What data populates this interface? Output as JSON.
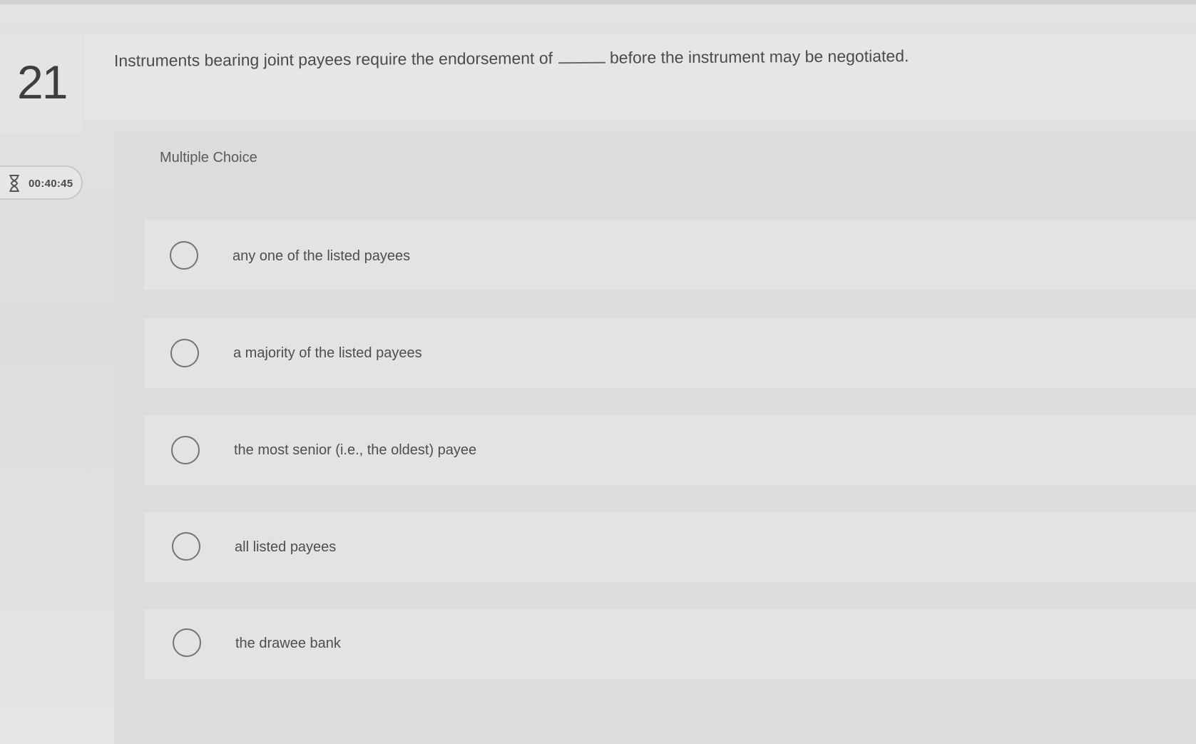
{
  "question": {
    "number": "21",
    "prompt_before": "Instruments bearing joint payees require the endorsement of",
    "prompt_after": "before the instrument may be negotiated."
  },
  "timer": {
    "icon": "hourglass-icon",
    "value": "00:40:45"
  },
  "question_type": "Multiple Choice",
  "options": [
    {
      "label": "any one of the listed payees"
    },
    {
      "label": "a majority of the listed payees"
    },
    {
      "label": "the most senior (i.e., the oldest) payee"
    },
    {
      "label": "all listed payees"
    },
    {
      "label": "the drawee bank"
    }
  ]
}
